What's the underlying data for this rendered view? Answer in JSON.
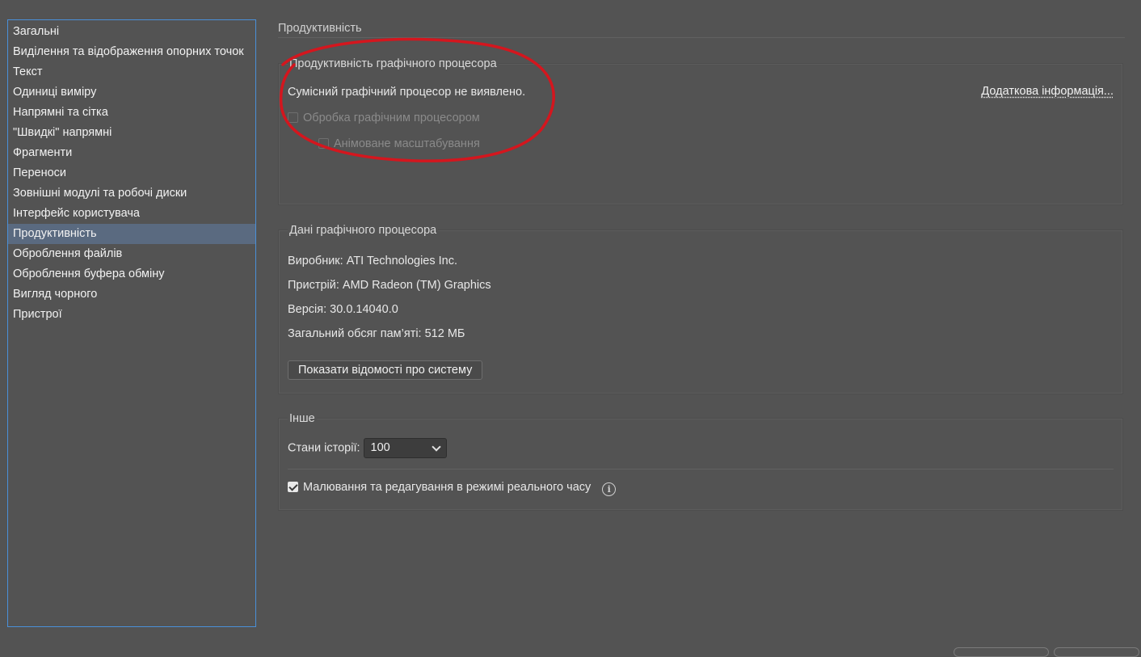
{
  "sidebar": {
    "items": [
      {
        "label": "Загальні"
      },
      {
        "label": "Виділення та відображення опорних точок"
      },
      {
        "label": "Текст"
      },
      {
        "label": "Одиниці виміру"
      },
      {
        "label": "Напрямні та сітка"
      },
      {
        "label": "\"Швидкі\" напрямні"
      },
      {
        "label": "Фрагменти"
      },
      {
        "label": "Переноси"
      },
      {
        "label": "Зовнішні модулі та робочі диски"
      },
      {
        "label": "Інтерфейс користувача"
      },
      {
        "label": "Продуктивність",
        "active": true
      },
      {
        "label": "Оброблення файлів"
      },
      {
        "label": "Оброблення буфера обміну"
      },
      {
        "label": "Вигляд чорного"
      },
      {
        "label": "Пристрої"
      }
    ]
  },
  "page": {
    "title": "Продуктивність"
  },
  "gpu_performance": {
    "legend": "Продуктивність графічного процесора",
    "message": "Сумісний графічний процесор не виявлено.",
    "more_info_link": "Додаткова інформація...",
    "gpu_processing": {
      "label": "Обробка графічним процесором",
      "checked": false,
      "disabled": true
    },
    "animated_zoom": {
      "label": "Анімоване масштабування",
      "checked": false,
      "disabled": true
    }
  },
  "gpu_details": {
    "legend": "Дані графічного процесора",
    "vendor": "Виробник: ATI Technologies Inc.",
    "device": "Пристрій: AMD Radeon (TM) Graphics",
    "version": "Версія: 30.0.14040.0",
    "memory": "Загальний обсяг пам’яті: 512 МБ",
    "system_info_button": "Показати відомості про систему"
  },
  "other": {
    "legend": "Інше",
    "history_states_label": "Стани історії:",
    "history_states_value": "100",
    "realtime_drawing": {
      "label": "Малювання та редагування в режимі реального часу",
      "checked": true
    }
  },
  "colors": {
    "background": "#535353",
    "sidebar_border": "#4a90d9",
    "sidebar_active": "#5a6a80",
    "annotation": "#d4161e"
  }
}
